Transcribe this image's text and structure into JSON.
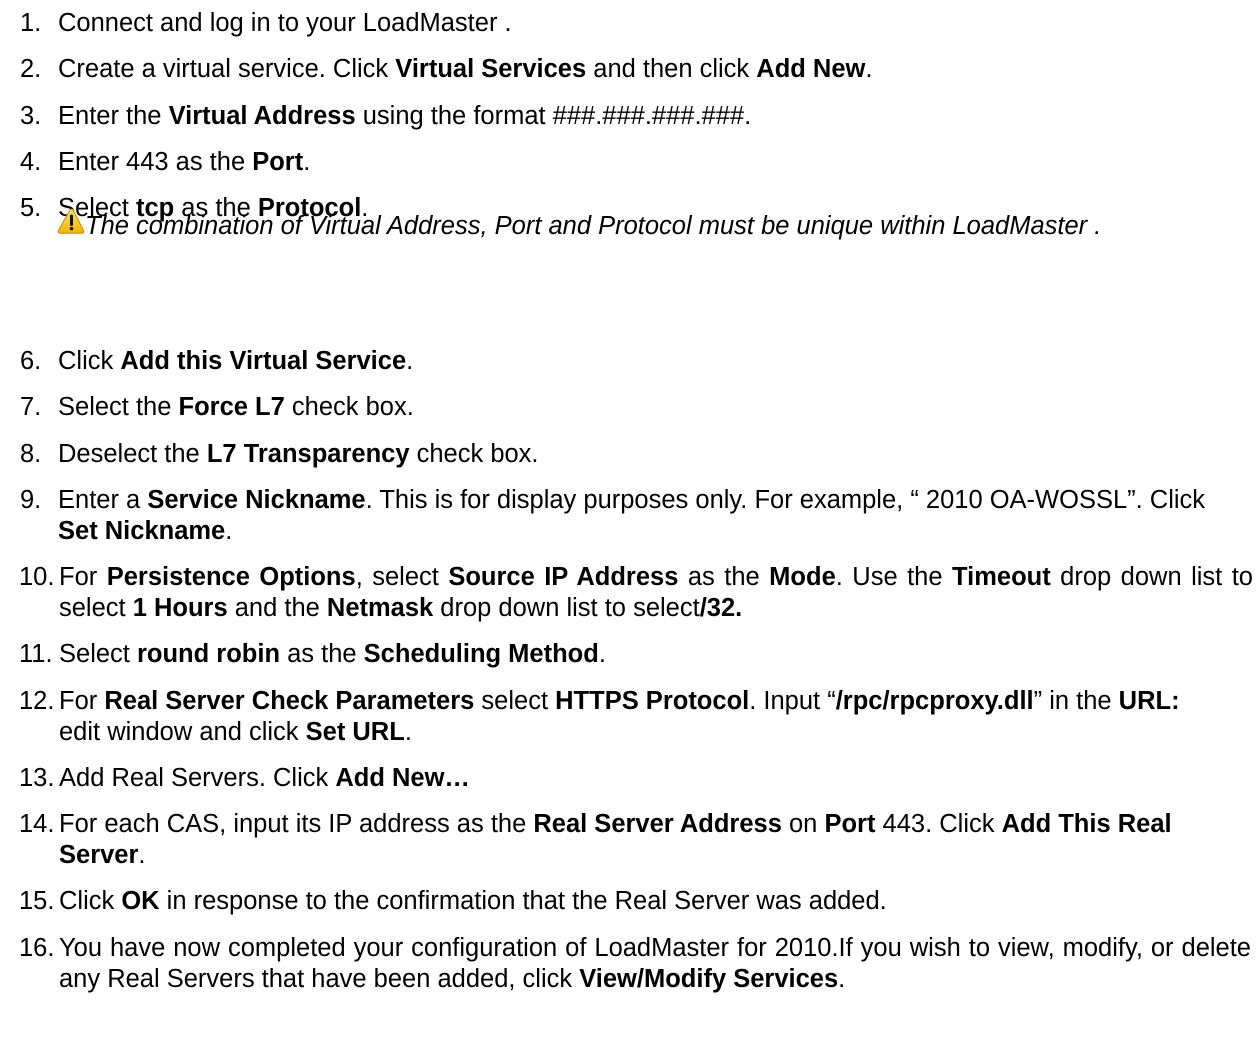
{
  "steps": [
    {
      "num": "1.",
      "parts": [
        {
          "t": "Connect and log in to your LoadMaster  ."
        }
      ]
    },
    {
      "num": "2.",
      "parts": [
        {
          "t": "Create a virtual service. Click "
        },
        {
          "t": "Virtual Services",
          "b": true
        },
        {
          "t": " and then click "
        },
        {
          "t": "Add New",
          "b": true
        },
        {
          "t": "."
        }
      ]
    },
    {
      "num": "3.",
      "parts": [
        {
          "t": "Enter the "
        },
        {
          "t": "Virtual Address",
          "b": true
        },
        {
          "t": " using the format ###.###.###.###."
        }
      ]
    },
    {
      "num": "4.",
      "parts": [
        {
          "t": "Enter 443 as the "
        },
        {
          "t": "Port",
          "b": true
        },
        {
          "t": "."
        }
      ]
    },
    {
      "num": "5.",
      "parts": [
        {
          "t": "Select "
        },
        {
          "t": "tcp",
          "b": true
        },
        {
          "t": " as the "
        },
        {
          "t": "Protocol",
          "b": true
        },
        {
          "t": "."
        }
      ]
    },
    {
      "num": "6.",
      "parts": [
        {
          "t": "Click "
        },
        {
          "t": "Add this Virtual Service",
          "b": true
        },
        {
          "t": "."
        }
      ]
    },
    {
      "num": "7.",
      "parts": [
        {
          "t": "Select the "
        },
        {
          "t": "Force L7",
          "b": true
        },
        {
          "t": " check box."
        }
      ]
    },
    {
      "num": "8.",
      "parts": [
        {
          "t": "Deselect the "
        },
        {
          "t": "L7 Transparency",
          "b": true
        },
        {
          "t": " check box."
        }
      ]
    },
    {
      "num": "9.",
      "parts": [
        {
          "t": "Enter a "
        },
        {
          "t": "Service Nickname",
          "b": true
        },
        {
          "t": ". This is for display purposes only. For example, “ 2010 OA-WOSSL”. Click "
        },
        {
          "t": "Set Nickname",
          "b": true
        },
        {
          "t": "."
        }
      ]
    },
    {
      "num": "10.",
      "parts": [
        {
          "t": "For "
        },
        {
          "t": "Persistence Options",
          "b": true
        },
        {
          "t": ", select "
        },
        {
          "t": "Source IP Address",
          "b": true
        },
        {
          "t": " as the "
        },
        {
          "t": "Mode",
          "b": true
        },
        {
          "t": ". Use the "
        },
        {
          "t": "Timeout",
          "b": true
        },
        {
          "t": " drop down list to select "
        },
        {
          "t": "1 Hours",
          "b": true
        },
        {
          "t": " and the "
        },
        {
          "t": "Netmask",
          "b": true
        },
        {
          "t": " drop down list to select"
        },
        {
          "t": "/32.",
          "b": true
        }
      ]
    },
    {
      "num": "11.",
      "parts": [
        {
          "t": "Select "
        },
        {
          "t": "round robin",
          "b": true
        },
        {
          "t": " as the "
        },
        {
          "t": "Scheduling Method",
          "b": true
        },
        {
          "t": "."
        }
      ]
    },
    {
      "num": "12.",
      "parts": [
        {
          "t": "For "
        },
        {
          "t": "Real Server Check Parameters",
          "b": true
        },
        {
          "t": " select "
        },
        {
          "t": "HTTPS Protocol",
          "b": true
        },
        {
          "t": ". Input “"
        },
        {
          "t": "/rpc/rpcproxy.dll",
          "b": true
        },
        {
          "t": "” in the "
        },
        {
          "t": "URL:",
          "b": true
        },
        {
          "t": " edit window and click "
        },
        {
          "t": "Set URL",
          "b": true
        },
        {
          "t": "."
        }
      ]
    },
    {
      "num": "13.",
      "parts": [
        {
          "t": "Add Real Servers. Click "
        },
        {
          "t": "Add New…",
          "b": true
        }
      ]
    },
    {
      "num": "14.",
      "parts": [
        {
          "t": "For each CAS, input its IP address as the "
        },
        {
          "t": "Real Server Address",
          "b": true
        },
        {
          "t": " on "
        },
        {
          "t": "Port",
          "b": true
        },
        {
          "t": " 443. Click "
        },
        {
          "t": "Add This Real Server",
          "b": true
        },
        {
          "t": "."
        }
      ]
    },
    {
      "num": "15.",
      "parts": [
        {
          "t": "Click "
        },
        {
          "t": "OK",
          "b": true
        },
        {
          "t": " in response to the confirmation that the Real Server was added."
        }
      ]
    },
    {
      "num": "16.",
      "parts": [
        {
          "t": "You have now completed your configuration of LoadMaster for  2010.If you wish to view, modify, or delete any Real Servers that have been added, click "
        },
        {
          "t": "View/Modify Services",
          "b": true
        },
        {
          "t": "."
        }
      ]
    }
  ],
  "note": {
    "icon": "warning-icon",
    "text": "The combination of Virtual Address, Port and Protocol must be unique within LoadMaster  ."
  },
  "colors": {
    "text": "#000000",
    "background": "#ffffff",
    "warning_fill": "#f4c20d",
    "warning_stroke": "#c98a00"
  }
}
